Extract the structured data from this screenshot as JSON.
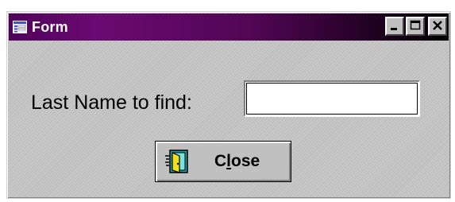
{
  "window": {
    "title": "Form",
    "title_icon": "form-icon",
    "controls": {
      "minimize_icon": "minimize-icon",
      "maximize_icon": "maximize-icon",
      "close_icon": "close-icon"
    }
  },
  "form": {
    "search_label": "Last Name to find:",
    "search_value": "",
    "close_button": {
      "label_before": "C",
      "label_accel": "l",
      "label_after": "ose",
      "icon": "door-exit-icon"
    }
  },
  "colors": {
    "titlebar_start": "#4e0258",
    "titlebar_end": "#000000",
    "window_face": "#c8c8c8"
  }
}
